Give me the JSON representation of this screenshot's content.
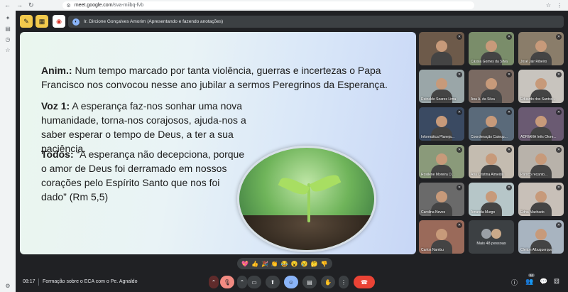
{
  "browser": {
    "url_host": "meet.google.com",
    "url_path": "/sva-miibq-fvb"
  },
  "toolbar": {
    "presenter_label": "Ir. Dircione Gonçalves Amorim (Apresentando e fazendo anotações)"
  },
  "slide": {
    "p1_speaker": "Anim.:",
    "p1_text": " Num tempo marcado por tanta violência, guerras e incertezas o Papa Francisco nos convocou nesse ano  jubilar  a sermos Peregrinos da Esperança.",
    "p2_speaker": "Voz 1:",
    "p2_text": " A esperança faz-nos sonhar uma nova humanidade, torna-nos corajosos, ajuda-nos a saber esperar o tempo de Deus, a ter a sua paciência.",
    "p3_speaker": "Todos:",
    "p3_text": " “A esperança não decepciona, porque o amor de Deus foi derramado em nossos corações pelo Espírito Santo que nos foi dado” (Rm 5,5)"
  },
  "participants": [
    {
      "name": "",
      "bg": "#6d5a4a"
    },
    {
      "name": "Cássia Gomes da Silva",
      "bg": "#7a8d6a"
    },
    {
      "name": "José Jair Ribeiro",
      "bg": "#8a7d6a"
    },
    {
      "name": "Reinaldo Soares Lima",
      "bg": "#9aa6a8"
    },
    {
      "name": "Ana A. da Silva",
      "bg": "#7a6a62"
    },
    {
      "name": "Eduardo dos Santos...",
      "bg": "#c8c4be"
    },
    {
      "name": "Informática Planeja...",
      "bg": "#3a4a62"
    },
    {
      "name": "Coordenação Catequ...",
      "bg": "#5a6a7a"
    },
    {
      "name": "ADRIANA Inês Olore...",
      "bg": "#6a5a72"
    },
    {
      "name": "Rosilene Moreira D...",
      "bg": "#8a9a7a"
    },
    {
      "name": "Ana Cristina Almeida",
      "bg": "#c4bcb0"
    },
    {
      "name": "Pároco recanto...",
      "bg": "#b8b2aa"
    },
    {
      "name": "Carolina Neves",
      "bg": "#6a6a6a"
    },
    {
      "name": "Amanda Murgo",
      "bg": "#b6c6c8"
    },
    {
      "name": "Edna Machado",
      "bg": "#c8c0b8"
    },
    {
      "name": "Carlos Nambu",
      "bg": "#9a6a5a"
    }
  ],
  "more_people": "Mais 48 pessoas",
  "last_participant": {
    "name": "Cleiton Albuquerque",
    "bg": "#a8b4c0"
  },
  "reactions": [
    "💖",
    "👍",
    "🎉",
    "👏",
    "😂",
    "😮",
    "😢",
    "🤔",
    "👎"
  ],
  "bottom": {
    "time": "08:17",
    "meeting_title": "Formação sobre o ECA com o Pe. Agnaldo",
    "people_count": "64"
  },
  "colors": {
    "leave": "#ea4335",
    "mic_muted": "#f28b82",
    "emoji_active": "#8ab4f8"
  }
}
